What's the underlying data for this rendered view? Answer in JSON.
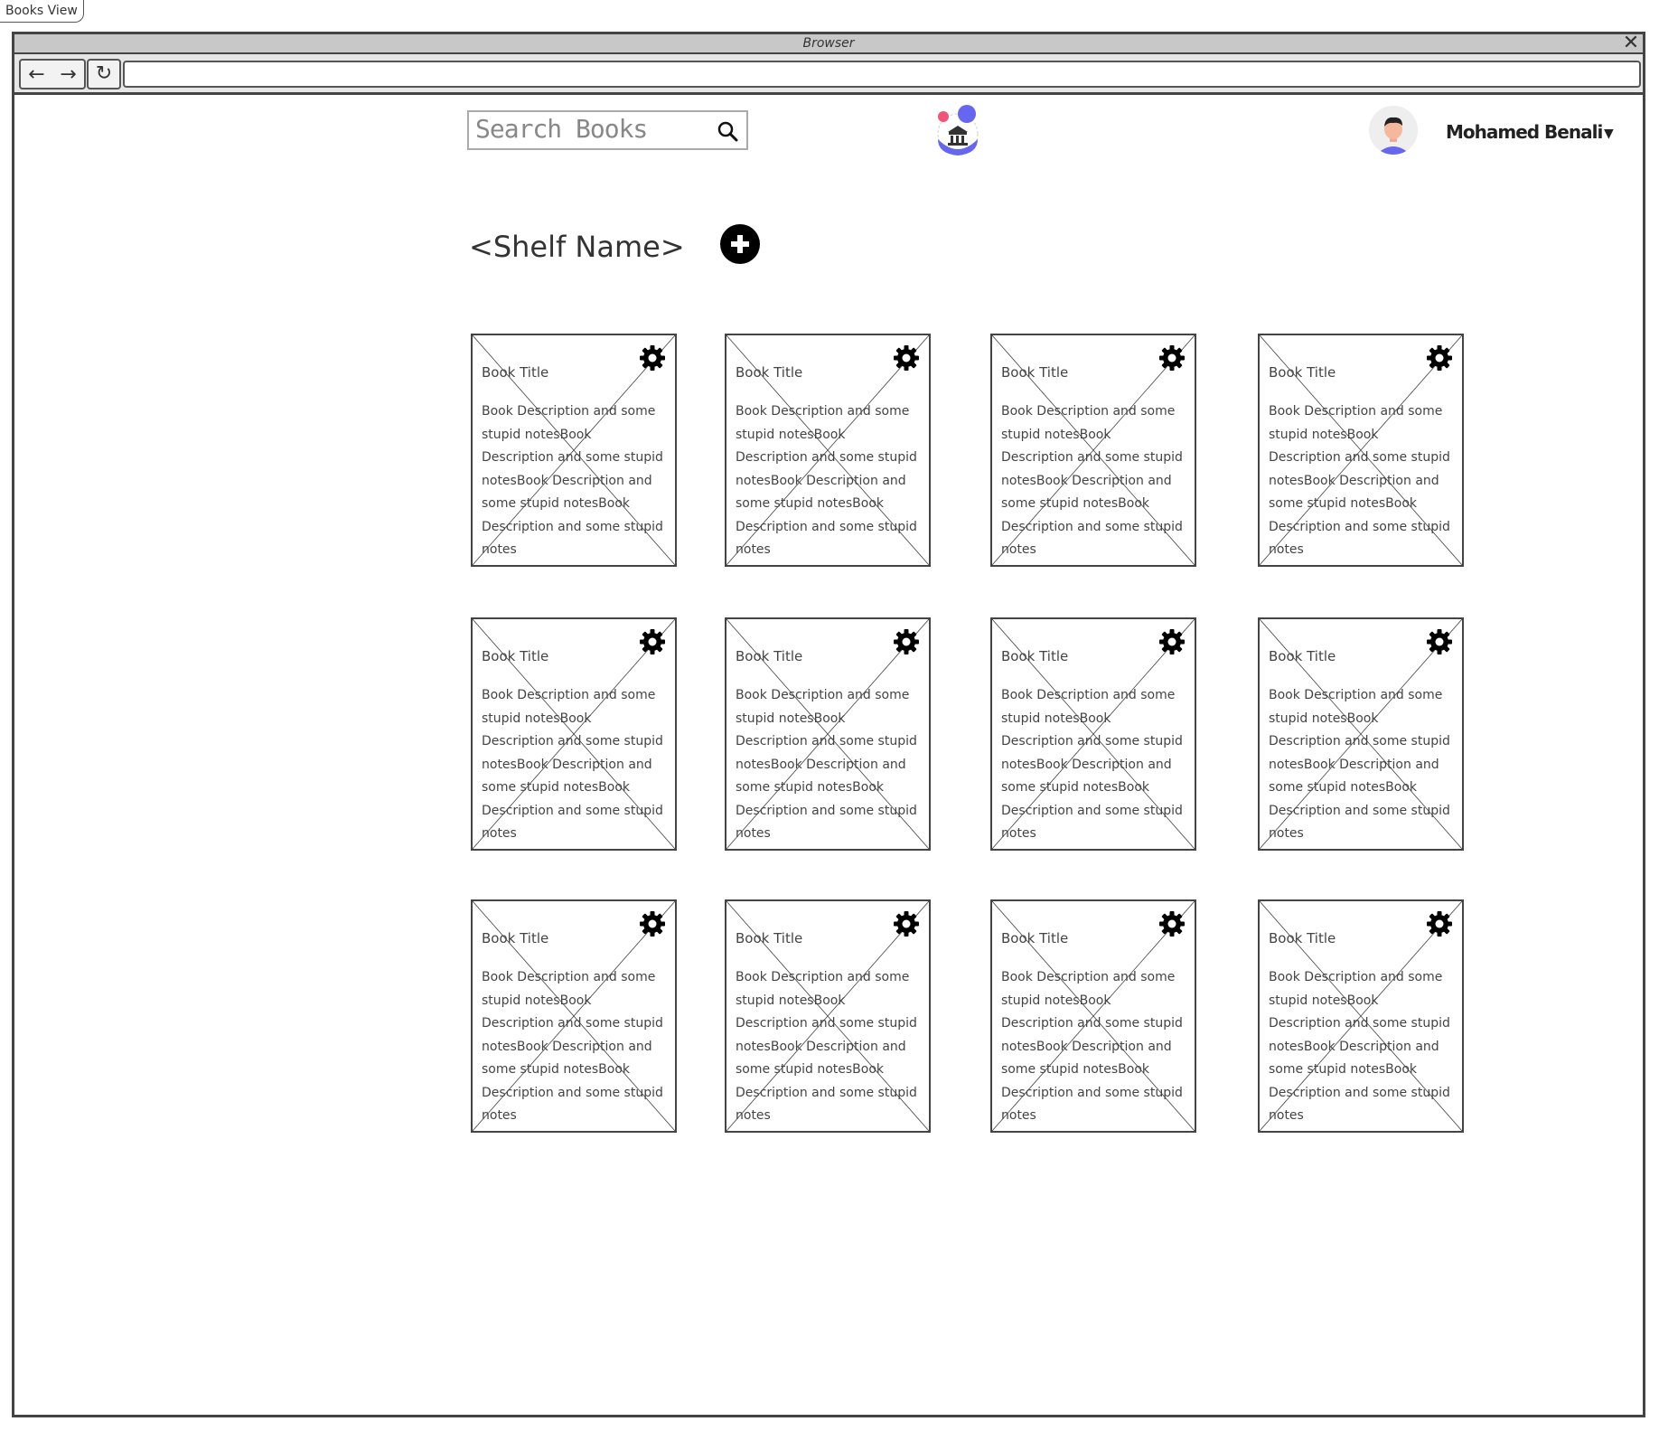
{
  "page": {
    "tab_label": "Books View"
  },
  "browser": {
    "title": "Browser",
    "close_glyph": "✕",
    "back_glyph": "←",
    "forward_glyph": "→",
    "reload_glyph": "↻",
    "url": ""
  },
  "header": {
    "search": {
      "placeholder": "Search Books",
      "icon": "search-icon"
    },
    "logo": {
      "icon": "library-logo"
    },
    "user": {
      "name": "Mohamed Benali",
      "avatar": "user-avatar",
      "caret": "▼"
    }
  },
  "shelf": {
    "name": "<Shelf Name>",
    "add_icon": "plus-circle-icon"
  },
  "books": [
    {
      "title": "Book Title",
      "description": "Book Description and some stupid notesBook Description and some stupid notesBook Description and some stupid notesBook Description and some stupid notes"
    },
    {
      "title": "Book Title",
      "description": "Book Description and some stupid notesBook Description and some stupid notesBook Description and some stupid notesBook Description and some stupid notes"
    },
    {
      "title": "Book Title",
      "description": "Book Description and some stupid notesBook Description and some stupid notesBook Description and some stupid notesBook Description and some stupid notes"
    },
    {
      "title": "Book Title",
      "description": "Book Description and some stupid notesBook Description and some stupid notesBook Description and some stupid notesBook Description and some stupid notes"
    },
    {
      "title": "Book Title",
      "description": "Book Description and some stupid notesBook Description and some stupid notesBook Description and some stupid notesBook Description and some stupid notes"
    },
    {
      "title": "Book Title",
      "description": "Book Description and some stupid notesBook Description and some stupid notesBook Description and some stupid notesBook Description and some stupid notes"
    },
    {
      "title": "Book Title",
      "description": "Book Description and some stupid notesBook Description and some stupid notesBook Description and some stupid notesBook Description and some stupid notes"
    },
    {
      "title": "Book Title",
      "description": "Book Description and some stupid notesBook Description and some stupid notesBook Description and some stupid notesBook Description and some stupid notes"
    },
    {
      "title": "Book Title",
      "description": "Book Description and some stupid notesBook Description and some stupid notesBook Description and some stupid notesBook Description and some stupid notes"
    },
    {
      "title": "Book Title",
      "description": "Book Description and some stupid notesBook Description and some stupid notesBook Description and some stupid notesBook Description and some stupid notes"
    },
    {
      "title": "Book Title",
      "description": "Book Description and some stupid notesBook Description and some stupid notesBook Description and some stupid notesBook Description and some stupid notes"
    },
    {
      "title": "Book Title",
      "description": "Book Description and some stupid notesBook Description and some stupid notesBook Description and some stupid notesBook Description and some stupid notes"
    }
  ],
  "colors": {
    "logo_pink": "#ee5577",
    "logo_purple": "#6666ee",
    "frame": "#444444"
  }
}
